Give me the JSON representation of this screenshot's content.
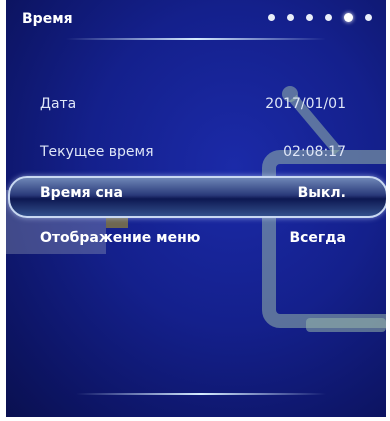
{
  "title": "Время",
  "page_indicator": {
    "count": 6,
    "active_index": 5
  },
  "settings": [
    {
      "label": "Дата",
      "value": "2017/01/01"
    },
    {
      "label": "Текущее время",
      "value": "02:08:17"
    },
    {
      "label": "Время сна",
      "value": "Выкл.",
      "selected": true
    },
    {
      "label": "Отображение меню",
      "value": "Всегда"
    }
  ],
  "colors": {
    "background": "#14208c",
    "text": "#dfe6f7",
    "selection_border": "#c9d9f2"
  }
}
